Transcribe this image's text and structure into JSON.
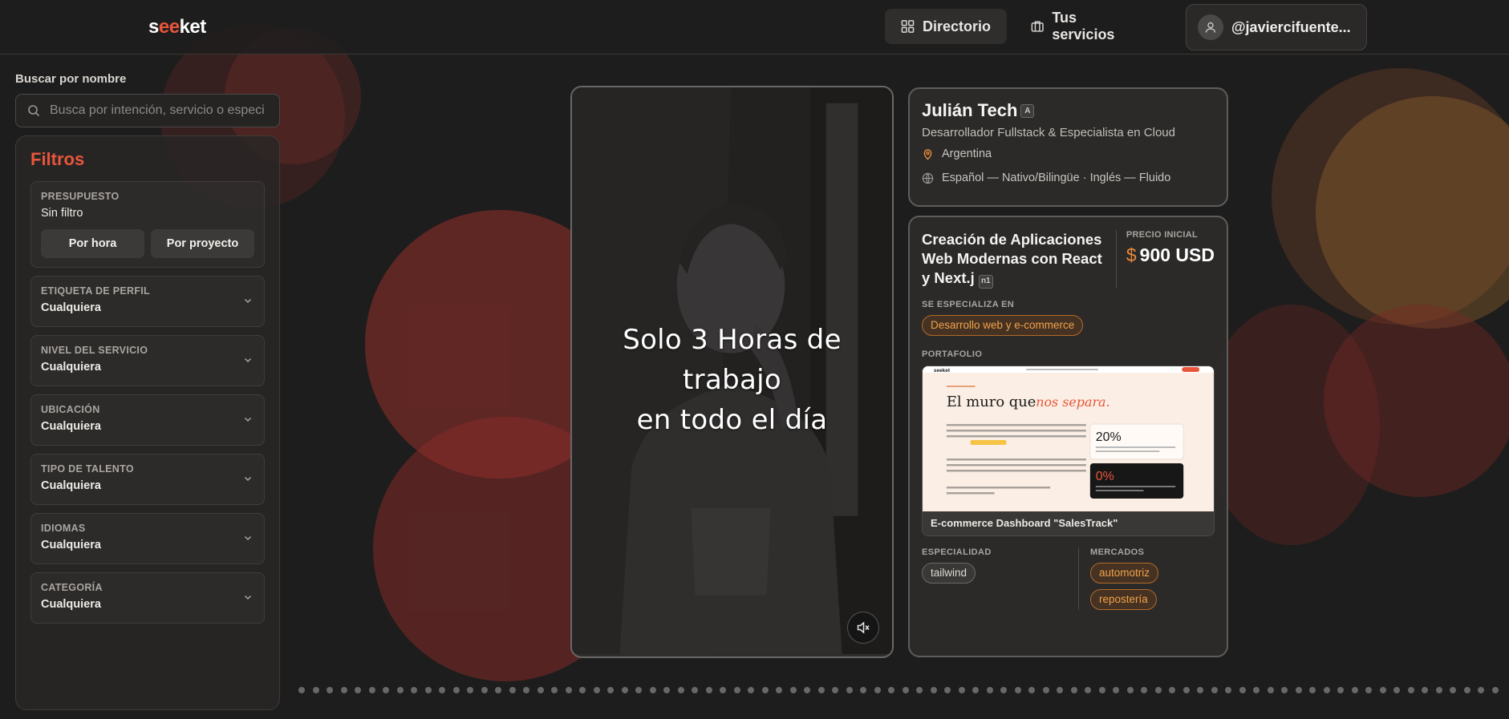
{
  "header": {
    "logo": {
      "s": "s",
      "ee": "ee",
      "ket": "ket"
    },
    "nav": [
      {
        "label": "Directorio",
        "icon": "grid-icon"
      },
      {
        "label": "Tus servicios",
        "icon": "briefcase-icon"
      }
    ],
    "user": {
      "handle": "@javiercifuente...",
      "icon": "user-icon"
    }
  },
  "sidebar": {
    "search_label": "Buscar por nombre",
    "search_placeholder": "Busca por intención, servicio o especi",
    "filters_title": "Filtros",
    "budget": {
      "label": "PRESUPUESTO",
      "value": "Sin filtro",
      "buttons": [
        "Por hora",
        "Por proyecto"
      ]
    },
    "selects": [
      {
        "label": "ETIQUETA DE PERFIL",
        "value": "Cualquiera"
      },
      {
        "label": "NIVEL DEL SERVICIO",
        "value": "Cualquiera"
      },
      {
        "label": "UBICACIÓN",
        "value": "Cualquiera"
      },
      {
        "label": "TIPO DE TALENTO",
        "value": "Cualquiera"
      },
      {
        "label": "IDIOMAS",
        "value": "Cualquiera"
      },
      {
        "label": "CATEGORÍA",
        "value": "Cualquiera"
      }
    ]
  },
  "video": {
    "caption_line1": "Solo 3 Horas de trabajo",
    "caption_line2": "en todo el día",
    "mute_icon": "volume-mute-icon"
  },
  "profile": {
    "name": "Julián Tech",
    "badge": "A",
    "role": "Desarrollador Fullstack & Especialista en Cloud",
    "location": "Argentina",
    "languages": "Español — Nativo/Bilingüe · Inglés — Fluido",
    "location_icon": "map-pin-icon",
    "language_icon": "globe-icon"
  },
  "service": {
    "title_line1": "Creación de Aplicaciones",
    "title_line2": "Web Modernas con React",
    "title_line3": "y Next.j",
    "badge": "n1",
    "price_label": "PRECIO INICIAL",
    "price_currency": "$",
    "price_value": "900 USD",
    "specializes_label": "SE ESPECIALIZA EN",
    "specializes": "Desarrollo web y e-commerce",
    "portfolio_label": "PORTAFOLIO",
    "portfolio_caption": "E-commerce Dashboard \"SalesTrack\"",
    "portfolio_preview": {
      "logo": "seeket",
      "headline_a": "El muro que",
      "headline_b": "nos separa.",
      "stat1": "20%",
      "stat2": "0%"
    },
    "specialty_label": "ESPECIALIDAD",
    "specialty_tags": [
      "tailwind"
    ],
    "markets_label": "MERCADOS",
    "markets_tags": [
      "automotriz",
      "repostería"
    ]
  },
  "colors": {
    "accent": "#e8553b",
    "price_currency": "#e88a3a",
    "pill_orange": "#f0a24b",
    "background": "#1e1d1d"
  }
}
